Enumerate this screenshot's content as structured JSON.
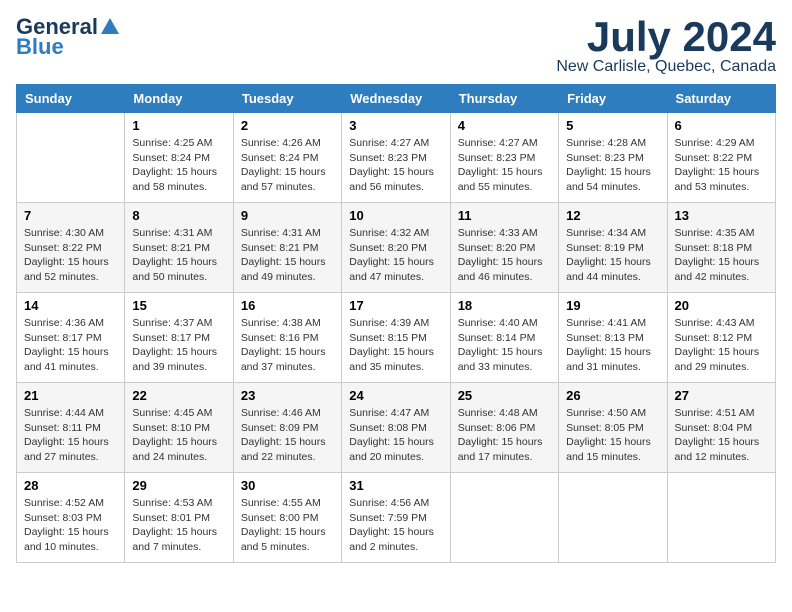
{
  "logo": {
    "general": "General",
    "blue": "Blue"
  },
  "header": {
    "month": "July 2024",
    "location": "New Carlisle, Quebec, Canada"
  },
  "weekdays": [
    "Sunday",
    "Monday",
    "Tuesday",
    "Wednesday",
    "Thursday",
    "Friday",
    "Saturday"
  ],
  "weeks": [
    [
      {
        "day": "",
        "info": ""
      },
      {
        "day": "1",
        "info": "Sunrise: 4:25 AM\nSunset: 8:24 PM\nDaylight: 15 hours\nand 58 minutes."
      },
      {
        "day": "2",
        "info": "Sunrise: 4:26 AM\nSunset: 8:24 PM\nDaylight: 15 hours\nand 57 minutes."
      },
      {
        "day": "3",
        "info": "Sunrise: 4:27 AM\nSunset: 8:23 PM\nDaylight: 15 hours\nand 56 minutes."
      },
      {
        "day": "4",
        "info": "Sunrise: 4:27 AM\nSunset: 8:23 PM\nDaylight: 15 hours\nand 55 minutes."
      },
      {
        "day": "5",
        "info": "Sunrise: 4:28 AM\nSunset: 8:23 PM\nDaylight: 15 hours\nand 54 minutes."
      },
      {
        "day": "6",
        "info": "Sunrise: 4:29 AM\nSunset: 8:22 PM\nDaylight: 15 hours\nand 53 minutes."
      }
    ],
    [
      {
        "day": "7",
        "info": "Sunrise: 4:30 AM\nSunset: 8:22 PM\nDaylight: 15 hours\nand 52 minutes."
      },
      {
        "day": "8",
        "info": "Sunrise: 4:31 AM\nSunset: 8:21 PM\nDaylight: 15 hours\nand 50 minutes."
      },
      {
        "day": "9",
        "info": "Sunrise: 4:31 AM\nSunset: 8:21 PM\nDaylight: 15 hours\nand 49 minutes."
      },
      {
        "day": "10",
        "info": "Sunrise: 4:32 AM\nSunset: 8:20 PM\nDaylight: 15 hours\nand 47 minutes."
      },
      {
        "day": "11",
        "info": "Sunrise: 4:33 AM\nSunset: 8:20 PM\nDaylight: 15 hours\nand 46 minutes."
      },
      {
        "day": "12",
        "info": "Sunrise: 4:34 AM\nSunset: 8:19 PM\nDaylight: 15 hours\nand 44 minutes."
      },
      {
        "day": "13",
        "info": "Sunrise: 4:35 AM\nSunset: 8:18 PM\nDaylight: 15 hours\nand 42 minutes."
      }
    ],
    [
      {
        "day": "14",
        "info": "Sunrise: 4:36 AM\nSunset: 8:17 PM\nDaylight: 15 hours\nand 41 minutes."
      },
      {
        "day": "15",
        "info": "Sunrise: 4:37 AM\nSunset: 8:17 PM\nDaylight: 15 hours\nand 39 minutes."
      },
      {
        "day": "16",
        "info": "Sunrise: 4:38 AM\nSunset: 8:16 PM\nDaylight: 15 hours\nand 37 minutes."
      },
      {
        "day": "17",
        "info": "Sunrise: 4:39 AM\nSunset: 8:15 PM\nDaylight: 15 hours\nand 35 minutes."
      },
      {
        "day": "18",
        "info": "Sunrise: 4:40 AM\nSunset: 8:14 PM\nDaylight: 15 hours\nand 33 minutes."
      },
      {
        "day": "19",
        "info": "Sunrise: 4:41 AM\nSunset: 8:13 PM\nDaylight: 15 hours\nand 31 minutes."
      },
      {
        "day": "20",
        "info": "Sunrise: 4:43 AM\nSunset: 8:12 PM\nDaylight: 15 hours\nand 29 minutes."
      }
    ],
    [
      {
        "day": "21",
        "info": "Sunrise: 4:44 AM\nSunset: 8:11 PM\nDaylight: 15 hours\nand 27 minutes."
      },
      {
        "day": "22",
        "info": "Sunrise: 4:45 AM\nSunset: 8:10 PM\nDaylight: 15 hours\nand 24 minutes."
      },
      {
        "day": "23",
        "info": "Sunrise: 4:46 AM\nSunset: 8:09 PM\nDaylight: 15 hours\nand 22 minutes."
      },
      {
        "day": "24",
        "info": "Sunrise: 4:47 AM\nSunset: 8:08 PM\nDaylight: 15 hours\nand 20 minutes."
      },
      {
        "day": "25",
        "info": "Sunrise: 4:48 AM\nSunset: 8:06 PM\nDaylight: 15 hours\nand 17 minutes."
      },
      {
        "day": "26",
        "info": "Sunrise: 4:50 AM\nSunset: 8:05 PM\nDaylight: 15 hours\nand 15 minutes."
      },
      {
        "day": "27",
        "info": "Sunrise: 4:51 AM\nSunset: 8:04 PM\nDaylight: 15 hours\nand 12 minutes."
      }
    ],
    [
      {
        "day": "28",
        "info": "Sunrise: 4:52 AM\nSunset: 8:03 PM\nDaylight: 15 hours\nand 10 minutes."
      },
      {
        "day": "29",
        "info": "Sunrise: 4:53 AM\nSunset: 8:01 PM\nDaylight: 15 hours\nand 7 minutes."
      },
      {
        "day": "30",
        "info": "Sunrise: 4:55 AM\nSunset: 8:00 PM\nDaylight: 15 hours\nand 5 minutes."
      },
      {
        "day": "31",
        "info": "Sunrise: 4:56 AM\nSunset: 7:59 PM\nDaylight: 15 hours\nand 2 minutes."
      },
      {
        "day": "",
        "info": ""
      },
      {
        "day": "",
        "info": ""
      },
      {
        "day": "",
        "info": ""
      }
    ]
  ]
}
